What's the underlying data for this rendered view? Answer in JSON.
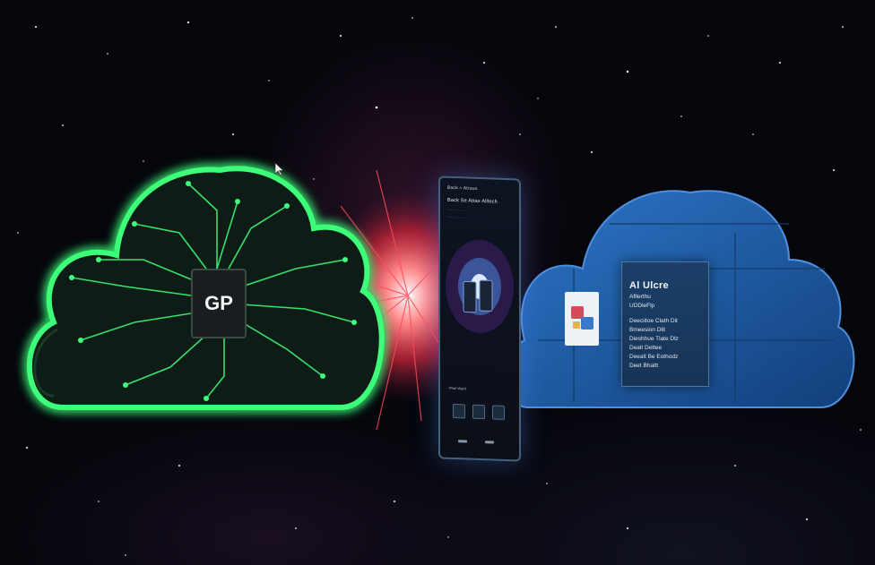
{
  "scene": {
    "background": "starry space with red-pink nebula burst",
    "colors": {
      "green_glow": "#3dff7a",
      "blue_cloud": "#1f5fa8",
      "burst": "#ff4b5c",
      "space": "#05060c"
    }
  },
  "green_cloud": {
    "chip_label": "GP",
    "icon": "circuit-board-icon"
  },
  "phone": {
    "header": "Back ≈ Atraux",
    "line1": "Back Se Attax Alllech",
    "line2": "........ .... ...",
    "line3": ".... ..........",
    "section_label": "Phet Ward"
  },
  "blue_cloud": {
    "panel": {
      "title": "Al Ulcre",
      "sub1": "Afllerthu",
      "sub2": "UDDleFlp",
      "row1": "Deeciitoe Clath Dit",
      "row2": "Bmeesion Dlit",
      "row3": "Dieshhue Tlate Dlz",
      "row4": "Dealt Dettee",
      "row5": "Deealt Be Eothodz",
      "row6": "Deet Bhaltt"
    }
  }
}
